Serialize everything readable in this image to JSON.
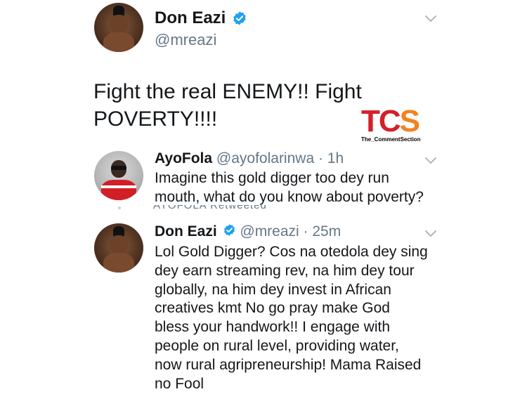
{
  "main_tweet": {
    "display_name": "Don Eazi",
    "handle": "@mreazi",
    "text_line1": "Fight the real ENEMY!! Fight",
    "text_line2": "POVERTY!!!!"
  },
  "watermark": {
    "logo_t": "T",
    "logo_c": "C",
    "logo_s": "S",
    "caption": "The_CommentSection"
  },
  "reply_tweet": {
    "display_name": "AyoFola",
    "handle_time": "@ayofolarinwa · 1h",
    "text_line1": "Imagine this gold digger too dey run",
    "text_line2": "mouth, what do you know about poverty?"
  },
  "retweet_bar": {
    "text": "AYOFOLA Retweeted"
  },
  "quote_tweet": {
    "display_name": "Don Eazi",
    "handle_time": "@mreazi · 25m",
    "lines": [
      "Lol Gold Digger? Cos na otedola dey sing",
      "dey earn streaming rev, na him dey tour",
      "globally, na him dey invest in African",
      "creatives kmt No go pray make God",
      "bless your handwork!! I engage with",
      "people on rural level, providing water,",
      "now rural agripreneurship! Mama Raised",
      "no Fool"
    ]
  },
  "colors": {
    "verified_blue": "#1da1f2",
    "tcs_red": "#d3202a",
    "tcs_orange": "#f58220",
    "chevron": "#aab8c2"
  },
  "icons": {
    "verified": "verified-badge-icon",
    "chevron": "chevron-down-icon"
  }
}
